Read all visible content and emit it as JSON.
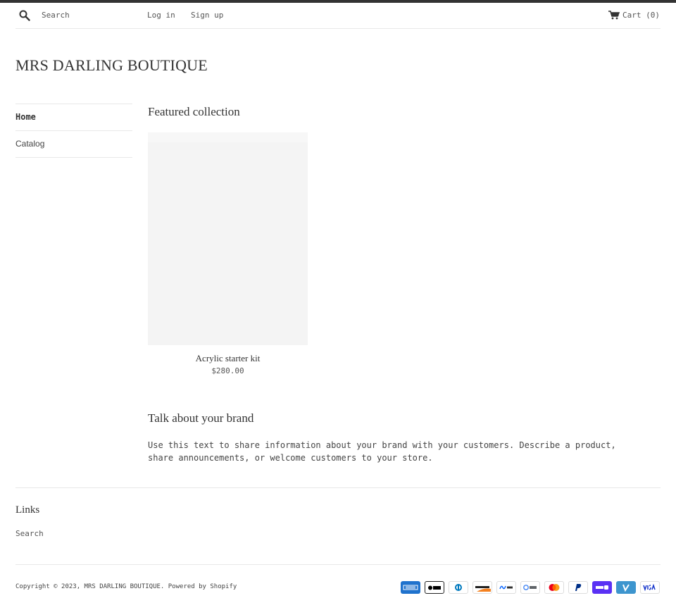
{
  "header": {
    "search_label": "Search",
    "login_label": "Log in",
    "signup_label": "Sign up",
    "cart_label": "Cart",
    "cart_count": "(0)"
  },
  "brand": {
    "name": "MRS DARLING BOUTIQUE"
  },
  "sidebar": {
    "items": [
      {
        "label": "Home"
      },
      {
        "label": "Catalog"
      }
    ]
  },
  "featured": {
    "title": "Featured collection",
    "product": {
      "title": "Acrylic starter kit",
      "price": "$280.00"
    }
  },
  "brand_section": {
    "title": "Talk about your brand",
    "text": "Use this text to share information about your brand with your customers. Describe a product, share announcements, or welcome customers to your store."
  },
  "footer": {
    "links_title": "Links",
    "search_link": "Search",
    "copyright_prefix": "Copyright © 2023,",
    "copyright_store": "MRS DARLING BOUTIQUE",
    "powered_by": "Powered by Shopify",
    "payment_icons": [
      "american-express",
      "apple-pay",
      "diners-club",
      "discover",
      "meta-pay",
      "google-pay",
      "mastercard",
      "paypal",
      "shop-pay",
      "venmo",
      "visa"
    ]
  },
  "colors": {
    "text": "#333333",
    "topbar": "#333333",
    "divider": "#e8e8e8",
    "placeholder": "#f4f4f4"
  }
}
